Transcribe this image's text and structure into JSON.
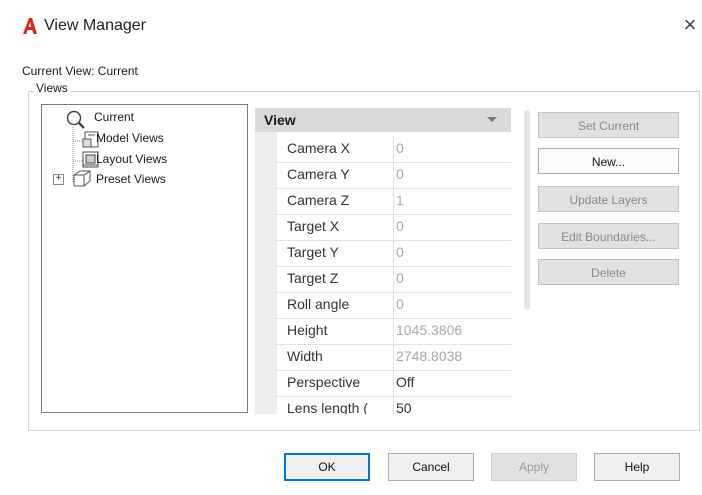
{
  "window": {
    "title": "View Manager",
    "close_glyph": "×",
    "logo_letter": "A",
    "accent_color": "#e0261b"
  },
  "current_view_label": "Current View: Current",
  "views_group_label": "Views",
  "tree": {
    "items": [
      {
        "label": "Current",
        "icon": "magnifier-icon"
      },
      {
        "label": "Model Views",
        "icon": "model-views-icon"
      },
      {
        "label": "Layout Views",
        "icon": "layout-views-icon"
      },
      {
        "label": "Preset Views",
        "icon": "preset-views-icon",
        "expander": "+"
      }
    ]
  },
  "properties": {
    "header": "View",
    "rows": [
      {
        "name": "Camera X",
        "value": "0"
      },
      {
        "name": "Camera Y",
        "value": "0"
      },
      {
        "name": "Camera Z",
        "value": "1"
      },
      {
        "name": "Target X",
        "value": "0"
      },
      {
        "name": "Target Y",
        "value": "0"
      },
      {
        "name": "Target Z",
        "value": "0"
      },
      {
        "name": "Roll angle",
        "value": "0"
      },
      {
        "name": "Height",
        "value": "1045.3806"
      },
      {
        "name": "Width",
        "value": "2748.8038"
      },
      {
        "name": "Perspective",
        "value": "Off"
      },
      {
        "name": "Lens length (",
        "value": "50"
      }
    ]
  },
  "side_buttons": {
    "set_current": "Set Current",
    "new": "New...",
    "update_layers": "Update Layers",
    "edit_boundaries": "Edit Boundaries...",
    "delete": "Delete"
  },
  "footer_buttons": {
    "ok": "OK",
    "cancel": "Cancel",
    "apply": "Apply",
    "help": "Help"
  }
}
